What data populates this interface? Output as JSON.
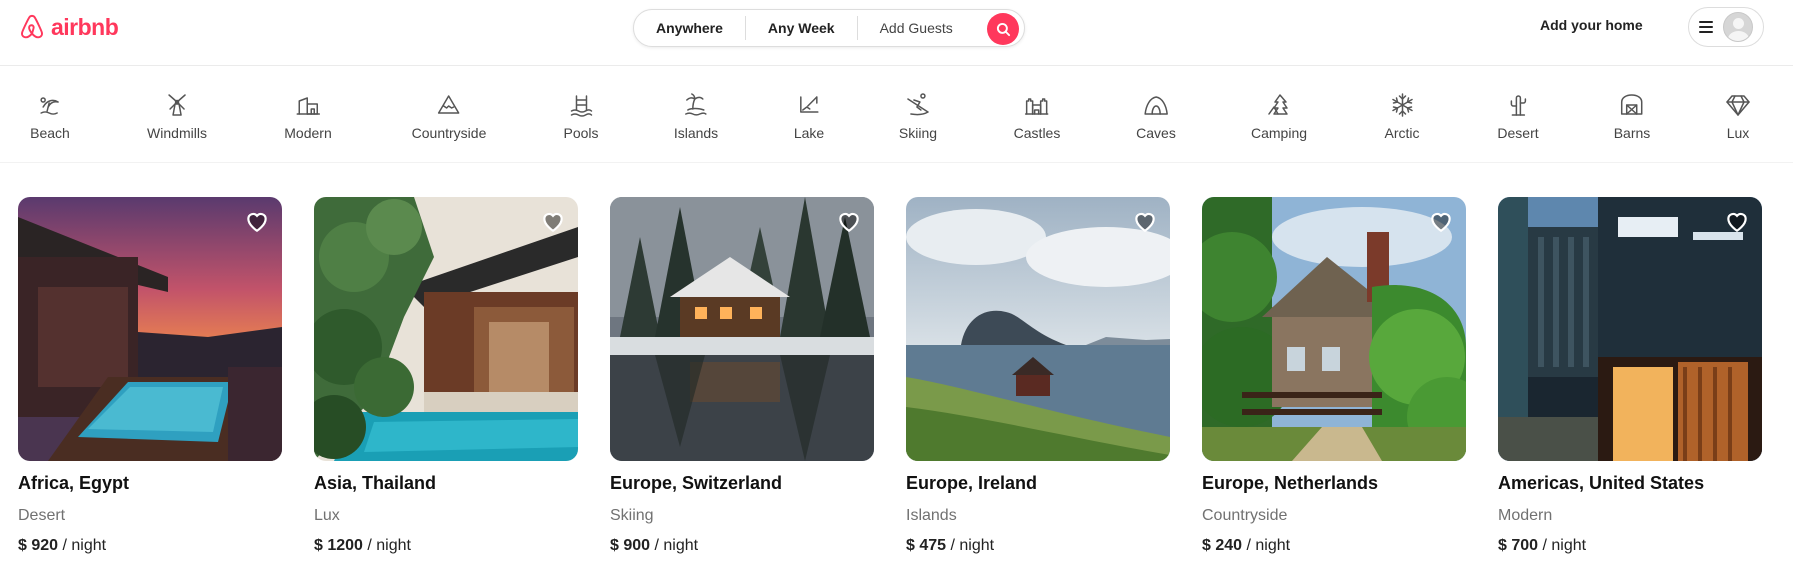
{
  "brand": {
    "name": "airbnb",
    "color": "#ff385c"
  },
  "search": {
    "location": "Anywhere",
    "dates": "Any Week",
    "guests": "Add Guests",
    "search_icon": "search-icon"
  },
  "header": {
    "host_link": "Add your home",
    "menu_icon": "hamburger-icon",
    "avatar_icon": "user-avatar"
  },
  "categories": [
    {
      "label": "Beach",
      "icon": "beach-icon"
    },
    {
      "label": "Windmills",
      "icon": "windmill-icon"
    },
    {
      "label": "Modern",
      "icon": "modern-house-icon"
    },
    {
      "label": "Countryside",
      "icon": "mountain-icon"
    },
    {
      "label": "Pools",
      "icon": "pool-icon"
    },
    {
      "label": "Islands",
      "icon": "island-icon"
    },
    {
      "label": "Lake",
      "icon": "lake-icon"
    },
    {
      "label": "Skiing",
      "icon": "skiing-icon"
    },
    {
      "label": "Castles",
      "icon": "castle-icon"
    },
    {
      "label": "Caves",
      "icon": "cave-icon"
    },
    {
      "label": "Camping",
      "icon": "camping-icon"
    },
    {
      "label": "Arctic",
      "icon": "snowflake-icon"
    },
    {
      "label": "Desert",
      "icon": "cactus-icon"
    },
    {
      "label": "Barns",
      "icon": "barn-icon"
    },
    {
      "label": "Lux",
      "icon": "diamond-icon"
    }
  ],
  "listings": [
    {
      "title": "Africa, Egypt",
      "category": "Desert",
      "price": "$ 920",
      "unit": "/ night"
    },
    {
      "title": "Asia, Thailand",
      "category": "Lux",
      "price": "$ 1200",
      "unit": "/ night"
    },
    {
      "title": "Europe, Switzerland",
      "category": "Skiing",
      "price": "$ 900",
      "unit": "/ night"
    },
    {
      "title": "Europe, Ireland",
      "category": "Islands",
      "price": "$ 475",
      "unit": "/ night"
    },
    {
      "title": "Europe, Netherlands",
      "category": "Countryside",
      "price": "$ 240",
      "unit": "/ night"
    },
    {
      "title": "Americas, United States",
      "category": "Modern",
      "price": "$ 700",
      "unit": "/ night"
    }
  ]
}
